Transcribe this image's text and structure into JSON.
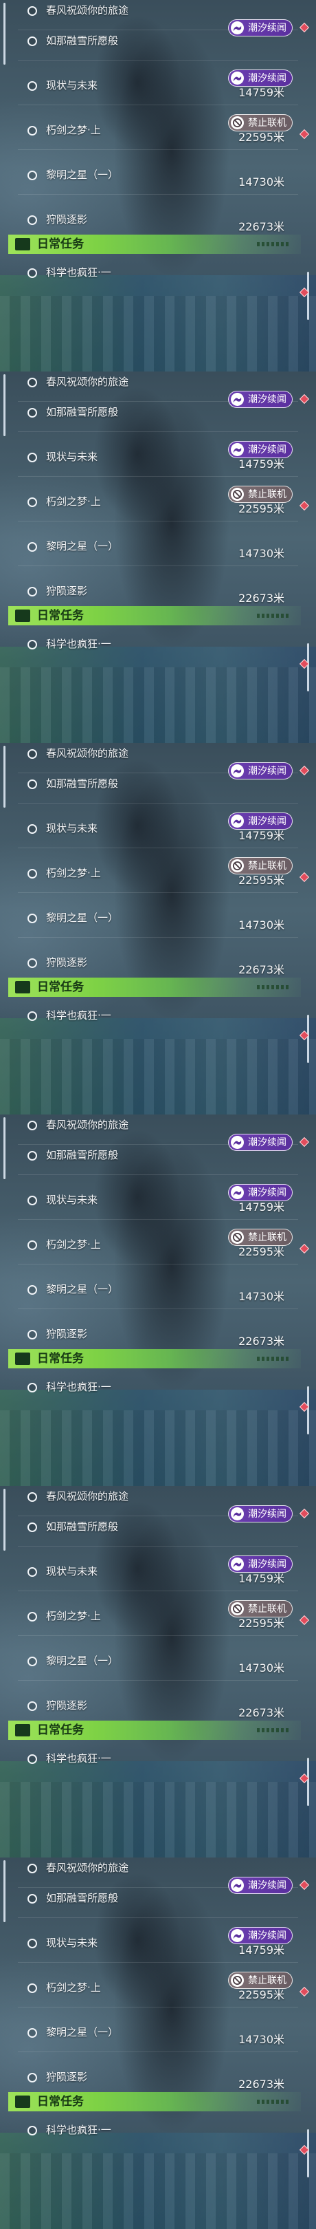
{
  "quests": [
    {
      "name": "春风祝颂你的旅途",
      "distance": null,
      "badge": null
    },
    {
      "name": "如那融雪所愿般",
      "distance": null,
      "badge": "潮汐续闻",
      "badge_style": "purple",
      "badge_icon": "tidal-wave-icon"
    },
    {
      "name": "现状与未来",
      "distance": "14759米",
      "badge": "潮汐续闻",
      "badge_style": "purple",
      "badge_icon": "tidal-wave-icon"
    },
    {
      "name": "朽剑之梦·上",
      "distance": "22595米",
      "badge": "禁止联机",
      "badge_style": "grey",
      "badge_icon": "no-coop-icon"
    },
    {
      "name": "黎明之星（一）",
      "distance": "14730米",
      "badge": null
    },
    {
      "name": "狩陨逐影",
      "distance": "22673米",
      "badge": null
    }
  ],
  "daily_section": {
    "title": "日常任务",
    "icon": "book-icon",
    "quests": [
      {
        "name": "科学也疯狂·一"
      }
    ]
  },
  "colors": {
    "tidal_badge": "#6b3fb0",
    "no_coop_badge": "#7d6f74",
    "alert_marker": "#e24c5c",
    "daily_header": "#9ee35a"
  }
}
